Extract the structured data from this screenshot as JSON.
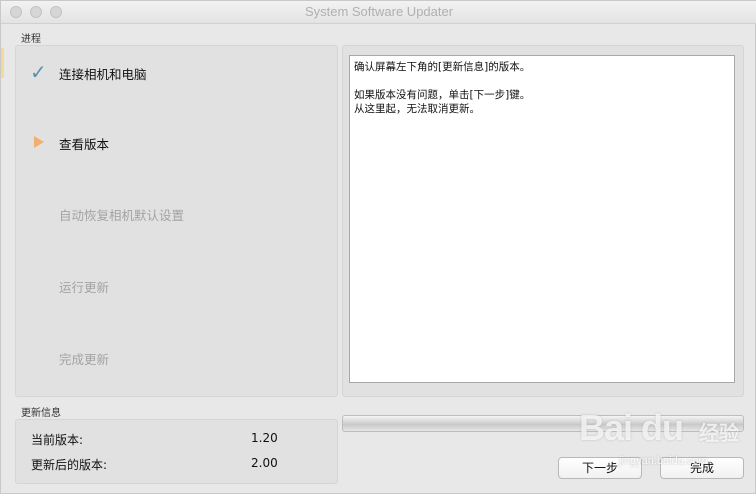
{
  "window": {
    "title": "System Software Updater"
  },
  "progress_section": {
    "label": "进程",
    "steps": [
      {
        "label": "连接相机和电脑",
        "state": "done",
        "icon": "check-icon"
      },
      {
        "label": "查看版本",
        "state": "current",
        "icon": "arrow-icon"
      },
      {
        "label": "自动恢复相机默认设置",
        "state": "pending"
      },
      {
        "label": "运行更新",
        "state": "pending"
      },
      {
        "label": "完成更新",
        "state": "pending"
      }
    ]
  },
  "message": {
    "lines": [
      "确认屏幕左下角的[更新信息]的版本。",
      "如果版本没有问题，单击[下一步]键。",
      "从这里起，无法取消更新。"
    ]
  },
  "update_info": {
    "label": "更新信息",
    "current_version_label": "当前版本:",
    "current_version_value": "1.20",
    "new_version_label": "更新后的版本:",
    "new_version_value": "2.00"
  },
  "progress": {
    "fraction": 0
  },
  "buttons": {
    "next_label": "下一步",
    "finish_label": "完成"
  },
  "watermark": {
    "logo": "Bai du",
    "cn": "经验",
    "url": "jingyan.baidu.com"
  },
  "colors": {
    "check": "#5b8fb3",
    "current_arrow": "#f0b070",
    "inactive_text": "#a3a3a3"
  }
}
